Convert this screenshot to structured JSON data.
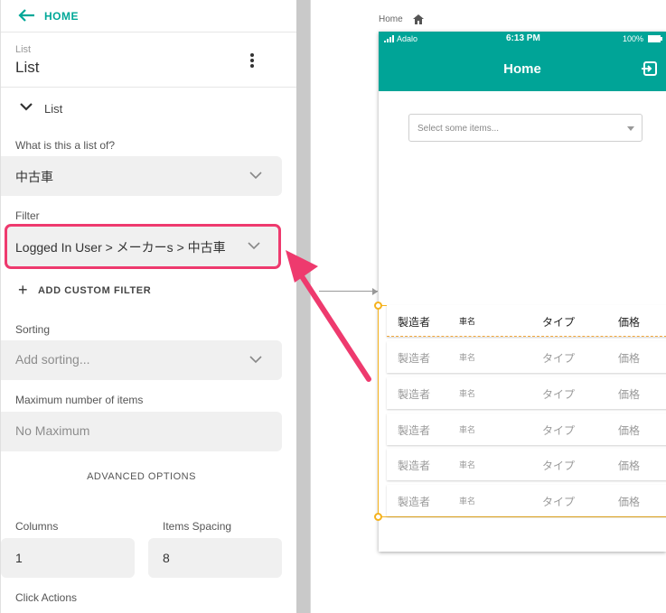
{
  "nav": {
    "back_label": "HOME"
  },
  "header": {
    "subtitle": "List",
    "title": "List"
  },
  "section": {
    "label": "List"
  },
  "fields": {
    "list_of": {
      "label": "What is this a list of?",
      "value": "中古車"
    },
    "filter": {
      "label": "Filter",
      "value": "Logged In User > メーカーs > 中古車"
    },
    "add_filter": "ADD CUSTOM FILTER",
    "sorting": {
      "label": "Sorting",
      "placeholder": "Add sorting..."
    },
    "max_items": {
      "label": "Maximum number of items",
      "value": "No Maximum"
    },
    "advanced": "ADVANCED OPTIONS",
    "columns": {
      "label": "Columns",
      "value": "1"
    },
    "spacing": {
      "label": "Items Spacing",
      "value": "8"
    },
    "click_actions": {
      "label": "Click Actions"
    }
  },
  "canvas": {
    "screen_label": "Home",
    "status": {
      "carrier": "Adalo",
      "time": "6:13 PM",
      "battery": "100%"
    },
    "app_title": "Home",
    "select_placeholder": "Select some items...",
    "rows": [
      {
        "c1": "製造者",
        "c2": "車名",
        "c3": "タイプ",
        "c4": "価格"
      },
      {
        "c1": "製造者",
        "c2": "車名",
        "c3": "タイプ",
        "c4": "価格"
      },
      {
        "c1": "製造者",
        "c2": "車名",
        "c3": "タイプ",
        "c4": "価格"
      },
      {
        "c1": "製造者",
        "c2": "車名",
        "c3": "タイプ",
        "c4": "価格"
      },
      {
        "c1": "製造者",
        "c2": "車名",
        "c3": "タイプ",
        "c4": "価格"
      },
      {
        "c1": "製造者",
        "c2": "車名",
        "c3": "タイプ",
        "c4": "価格"
      }
    ]
  },
  "colors": {
    "accent": "#00a497",
    "highlight": "#ee3a6e",
    "selection": "#f5b21d"
  }
}
